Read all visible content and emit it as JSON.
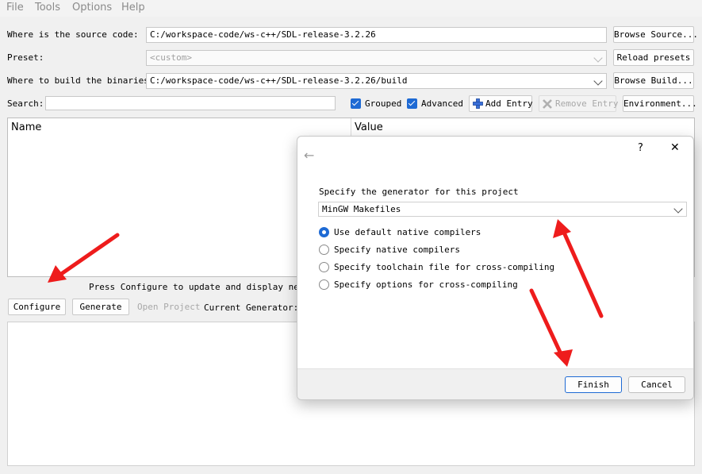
{
  "menu": [
    "File",
    "Tools",
    "Options",
    "Help"
  ],
  "source": {
    "label": "Where is the source code:",
    "value": "C:/workspace-code/ws-c++/SDL-release-3.2.26",
    "browse_label": "Browse Source..."
  },
  "preset": {
    "label": "Preset:",
    "value": "<custom>",
    "reload_label": "Reload presets"
  },
  "build": {
    "label": "Where to build the binaries:",
    "value": "C:/workspace-code/ws-c++/SDL-release-3.2.26/build",
    "browse_label": "Browse Build..."
  },
  "search": {
    "label": "Search:",
    "value": ""
  },
  "options": {
    "grouped": {
      "label": "Grouped",
      "checked": true
    },
    "advanced": {
      "label": "Advanced",
      "checked": true
    },
    "add_entry": "Add Entry",
    "remove_entry": "Remove Entry",
    "environment": "Environment..."
  },
  "table": {
    "columns": [
      "Name",
      "Value"
    ]
  },
  "status_text": "Press Configure to update and display new va",
  "actions": {
    "configure": "Configure",
    "generate": "Generate",
    "open_project": "Open Project",
    "current_generator": "Current Generator: N"
  },
  "dialog": {
    "help": "?",
    "close": "✕",
    "back": "←",
    "prompt": "Specify the generator for this project",
    "generator": "MinGW Makefiles",
    "radios": [
      {
        "label": "Use default native compilers",
        "selected": true
      },
      {
        "label": "Specify native compilers",
        "selected": false
      },
      {
        "label": "Specify toolchain file for cross-compiling",
        "selected": false
      },
      {
        "label": "Specify options for cross-compiling",
        "selected": false
      }
    ],
    "finish": "Finish",
    "cancel": "Cancel"
  },
  "colors": {
    "accent": "#1e6ad4",
    "annotation_arrow": "#ee1c1c"
  }
}
